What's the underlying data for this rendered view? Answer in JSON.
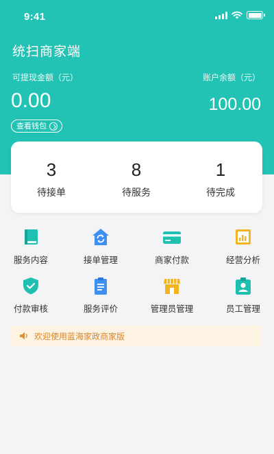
{
  "status_bar": {
    "time": "9:41"
  },
  "header": {
    "title": "统扫商家端",
    "withdrawable_label": "可提现金额（元）",
    "withdrawable_amount": "0.00",
    "balance_label": "账户余额（元）",
    "balance_amount": "100.00",
    "wallet_button": "查看钱包"
  },
  "orders": [
    {
      "count": "3",
      "label": "待接单"
    },
    {
      "count": "8",
      "label": "待服务"
    },
    {
      "count": "1",
      "label": "待完成"
    }
  ],
  "menu": [
    {
      "label": "服务内容",
      "icon": "book-icon"
    },
    {
      "label": "接单管理",
      "icon": "refresh-house-icon"
    },
    {
      "label": "商家付款",
      "icon": "card-icon"
    },
    {
      "label": "经营分析",
      "icon": "chart-icon"
    },
    {
      "label": "付款审核",
      "icon": "shield-check-icon"
    },
    {
      "label": "服务评价",
      "icon": "clipboard-icon"
    },
    {
      "label": "管理员管理",
      "icon": "store-icon"
    },
    {
      "label": "员工管理",
      "icon": "badge-icon"
    }
  ],
  "notice": {
    "text": "欢迎使用蓝海家政商家版",
    "icon": "speaker-icon"
  },
  "colors": {
    "primary": "#22c3b4",
    "icon_teal": "#1fbfb1",
    "icon_blue": "#3d8ff0",
    "icon_yellow": "#f2b41f",
    "notice_bg": "#fdf3e2",
    "notice_text": "#d9862b"
  }
}
